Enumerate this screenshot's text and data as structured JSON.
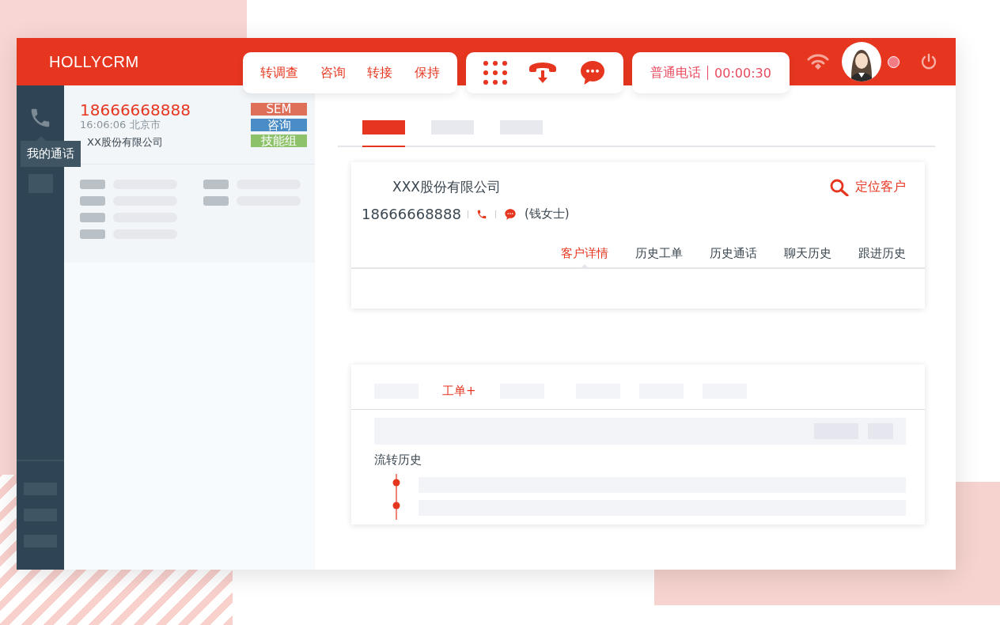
{
  "header": {
    "logo": "HOLLYCRM",
    "actions": [
      "转调查",
      "咨询",
      "转接",
      "保持"
    ],
    "call_type": "普通电话",
    "timer": "00:00:30"
  },
  "sidebar": {
    "tooltip": "我的通话"
  },
  "call": {
    "phone": "18666668888",
    "time_place": "16:06:06 北京市",
    "company": "XX股份有限公司",
    "tags": [
      {
        "label": "SEM",
        "color": "#de6f59"
      },
      {
        "label": "咨询",
        "color": "#4a8dc6"
      },
      {
        "label": "技能组",
        "color": "#8dc26b"
      }
    ]
  },
  "top_tabs": [
    {
      "selected": true
    },
    {
      "selected": false
    },
    {
      "selected": false
    }
  ],
  "customer": {
    "company": "XXX股份有限公司",
    "locate": "定位客户",
    "phone": "18666668888",
    "contact": "(钱女士)",
    "tabs": [
      {
        "label": "客户详情",
        "selected": true
      },
      {
        "label": "历史工单",
        "selected": false
      },
      {
        "label": "历史通话",
        "selected": false
      },
      {
        "label": "聊天历史",
        "selected": false
      },
      {
        "label": "跟进历史",
        "selected": false
      }
    ]
  },
  "ticket": {
    "tab": "工单+",
    "history_title": "流转历史"
  }
}
